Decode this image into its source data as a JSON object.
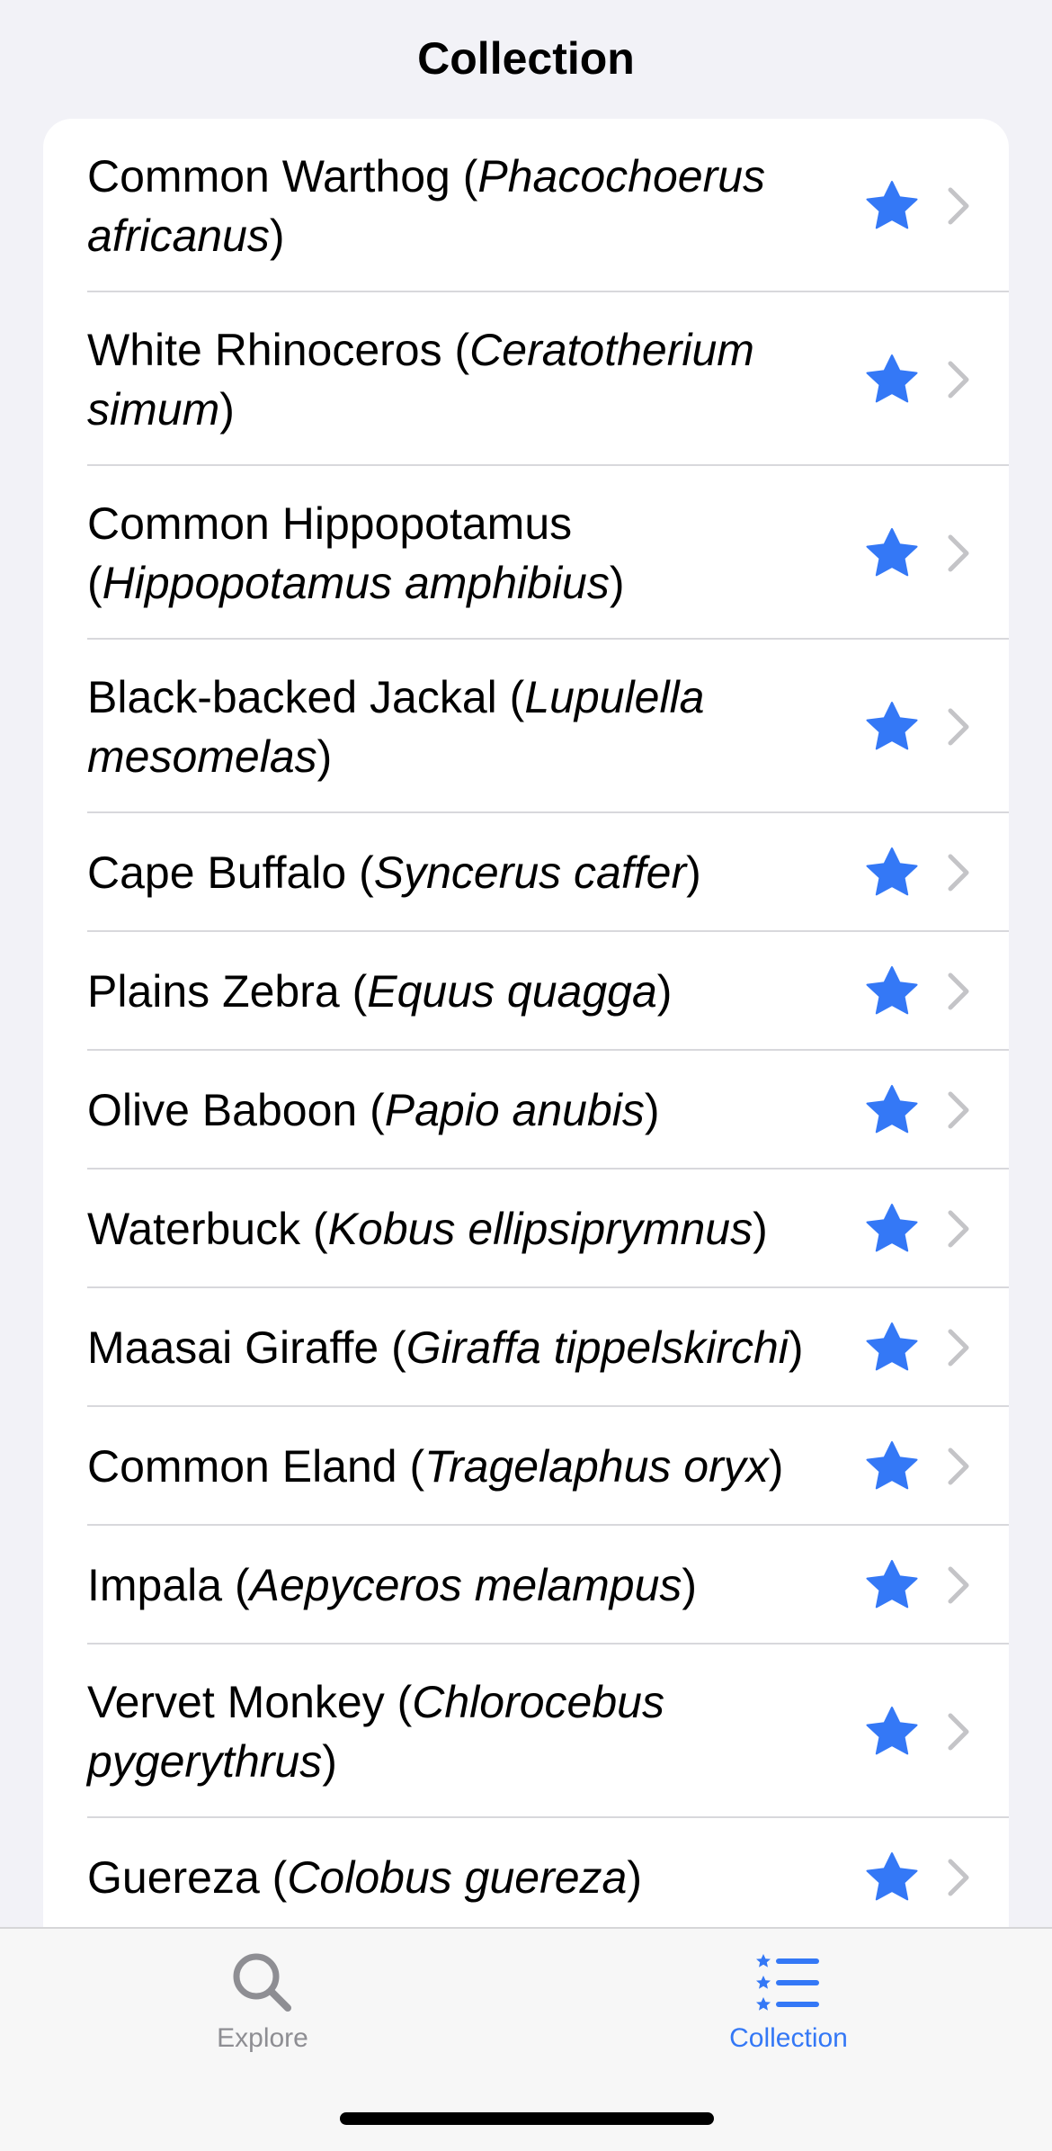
{
  "header": {
    "title": "Collection"
  },
  "colors": {
    "accent": "#3478F6",
    "chevron": "#C4C4C7",
    "tab_inactive": "#8E8E93"
  },
  "list": {
    "items": [
      {
        "common": "Common Warthog",
        "open": " (",
        "scientific": "Phacochoerus africanus",
        "close": ")",
        "lines": 2,
        "icon": "star-filled-icon"
      },
      {
        "common": "White Rhinoceros",
        "open": " (",
        "scientific": "Ceratotherium simum",
        "close": ")",
        "lines": 2,
        "icon": "star-filled-icon"
      },
      {
        "common": "Common Hippopotamus",
        "open": " (",
        "scientific": "Hippopotamus amphibius",
        "close": ")",
        "lines": 2,
        "icon": "star-filled-icon"
      },
      {
        "common": "Black-backed Jackal",
        "open": " (",
        "scientific": "Lupulella mesomelas",
        "close": ")",
        "lines": 2,
        "icon": "star-filled-icon"
      },
      {
        "common": "Cape Buffalo",
        "open": " (",
        "scientific": "Syncerus caffer",
        "close": ")",
        "lines": 1,
        "icon": "star-filled-icon"
      },
      {
        "common": "Plains Zebra",
        "open": " (",
        "scientific": "Equus quagga",
        "close": ")",
        "lines": 1,
        "icon": "star-filled-icon"
      },
      {
        "common": "Olive Baboon",
        "open": " (",
        "scientific": "Papio anubis",
        "close": ")",
        "lines": 1,
        "icon": "star-filled-icon"
      },
      {
        "common": "Waterbuck",
        "open": " (",
        "scientific": "Kobus ellipsiprymnus",
        "close": ")",
        "lines": 1,
        "icon": "star-filled-icon"
      },
      {
        "common": "Maasai Giraffe",
        "open": " (",
        "scientific": "Giraffa tippelskirchi",
        "close": ")",
        "lines": 1,
        "icon": "star-filled-icon"
      },
      {
        "common": "Common Eland",
        "open": " (",
        "scientific": "Tragelaphus oryx",
        "close": ")",
        "lines": 1,
        "icon": "star-filled-icon"
      },
      {
        "common": "Impala",
        "open": " (",
        "scientific": "Aepyceros melampus",
        "close": ")",
        "lines": 1,
        "icon": "star-filled-icon"
      },
      {
        "common": "Vervet Monkey",
        "open": " (",
        "scientific": "Chlorocebus pygerythrus",
        "close": ")",
        "lines": 2,
        "icon": "star-filled-icon"
      },
      {
        "common": "Guereza",
        "open": " (",
        "scientific": "Colobus guereza",
        "close": ")",
        "lines": 1,
        "icon": "star-filled-icon"
      }
    ]
  },
  "tabbar": {
    "explore": {
      "label": "Explore",
      "icon": "search-icon"
    },
    "collection": {
      "label": "Collection",
      "icon": "starred-list-icon",
      "selected": true
    }
  }
}
